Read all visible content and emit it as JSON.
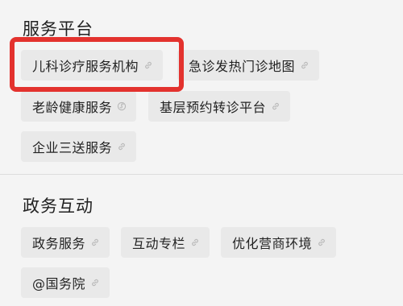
{
  "sections": [
    {
      "title": "服务平台",
      "items": [
        {
          "label": "儿科诊疗服务机构",
          "icon": "link-icon"
        },
        {
          "label": "急诊发热门诊地图",
          "icon": "link-icon"
        },
        {
          "label": "老龄健康服务",
          "icon": "mini-program-icon"
        },
        {
          "label": "基层预约转诊平台",
          "icon": "link-icon"
        },
        {
          "label": "企业三送服务",
          "icon": "link-icon"
        }
      ]
    },
    {
      "title": "政务互动",
      "items": [
        {
          "label": "政务服务",
          "icon": "link-icon"
        },
        {
          "label": "互动专栏",
          "icon": "link-icon"
        },
        {
          "label": "优化营商环境",
          "icon": "link-icon"
        },
        {
          "label": "@国务院",
          "icon": "link-icon"
        }
      ]
    }
  ],
  "colors": {
    "highlight": "#e3322e",
    "chip_bg": "#e9e9e9",
    "icon": "#b8b8b8"
  }
}
